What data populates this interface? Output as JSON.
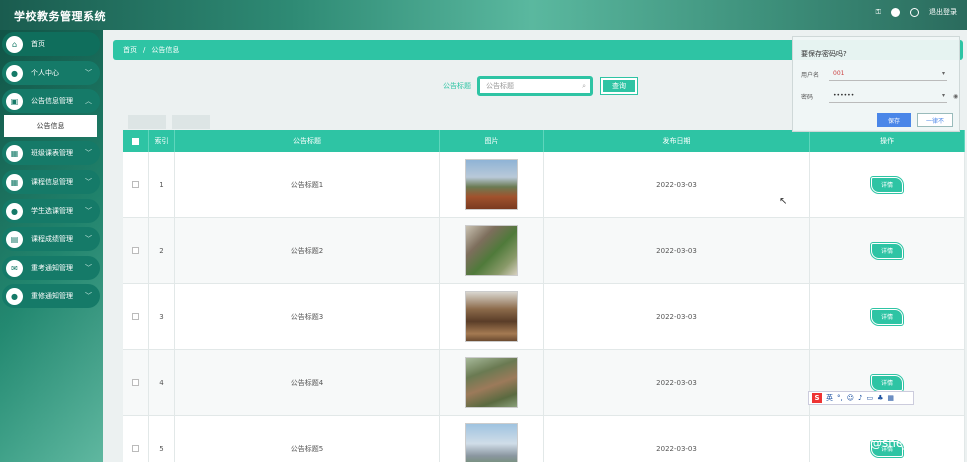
{
  "header": {
    "title": "学校教务管理系统",
    "logout": "退出登录"
  },
  "sidebar": {
    "items": [
      {
        "label": "首页",
        "icon": "home-icon",
        "glyph": "⌂"
      },
      {
        "label": "个人中心",
        "icon": "user-icon",
        "glyph": "●"
      },
      {
        "label": "公告信息管理",
        "icon": "briefcase-icon",
        "glyph": "▣"
      },
      {
        "label": "班级课表管理",
        "icon": "grid-icon",
        "glyph": "▦"
      },
      {
        "label": "课程信息管理",
        "icon": "grid-icon",
        "glyph": "▦"
      },
      {
        "label": "学生选课管理",
        "icon": "user-icon",
        "glyph": "●"
      },
      {
        "label": "课程成绩管理",
        "icon": "table-icon",
        "glyph": "▤"
      },
      {
        "label": "重考通知管理",
        "icon": "mail-icon",
        "glyph": "✉"
      },
      {
        "label": "重修通知管理",
        "icon": "user-icon",
        "glyph": "●"
      }
    ],
    "submenu": "公告信息"
  },
  "breadcrumb": {
    "home": "首页",
    "sep": "/",
    "current": "公告信息"
  },
  "search": {
    "label": "公告标题",
    "placeholder": "公告标题",
    "button": "查询"
  },
  "table": {
    "headers": [
      "索引",
      "公告标题",
      "图片",
      "发布日期",
      "操作"
    ],
    "rows": [
      {
        "idx": "1",
        "title": "公告标题1",
        "date": "2022-03-03",
        "action": "详情"
      },
      {
        "idx": "2",
        "title": "公告标题2",
        "date": "2022-03-03",
        "action": "详情"
      },
      {
        "idx": "3",
        "title": "公告标题3",
        "date": "2022-03-03",
        "action": "详情"
      },
      {
        "idx": "4",
        "title": "公告标题4",
        "date": "2022-03-03",
        "action": "详情"
      },
      {
        "idx": "5",
        "title": "公告标题5",
        "date": "2022-03-03",
        "action": "详情"
      }
    ]
  },
  "password_popup": {
    "title": "要保存密码吗?",
    "username_label": "用户名",
    "username_value": "001",
    "password_label": "密码",
    "password_value": "••••••",
    "save": "保存",
    "never": "一律不"
  },
  "ime": {
    "logo": "S",
    "mode": "英"
  },
  "watermark": "CSDN @sheji1071"
}
